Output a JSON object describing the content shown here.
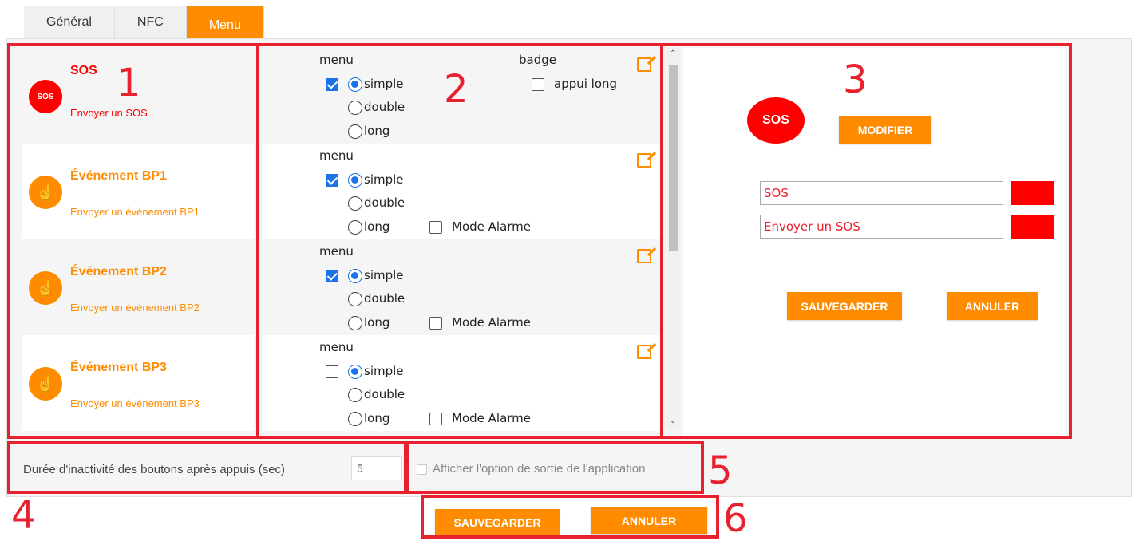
{
  "tabs": [
    {
      "label": "Général"
    },
    {
      "label": "NFC"
    },
    {
      "label": "Menu"
    }
  ],
  "annotations": [
    "1",
    "2",
    "3",
    "4",
    "5",
    "6"
  ],
  "items": [
    {
      "icon": "SOS",
      "title": "SOS",
      "subtitle": "Envoyer un SOS",
      "color": "#ff0000"
    },
    {
      "icon": "hand-press-icon",
      "title": "Événement BP1",
      "subtitle": "Envoyer un événement BP1",
      "color": "#ff8c00"
    },
    {
      "icon": "hand-press-icon",
      "title": "Événement BP2",
      "subtitle": "Envoyer un événement BP2",
      "color": "#ff8c00"
    },
    {
      "icon": "hand-press-icon",
      "title": "Événement BP3",
      "subtitle": "Envoyer un événement BP3",
      "color": "#ff8c00"
    }
  ],
  "config": {
    "menu_label": "menu",
    "badge_label": "badge",
    "long_press_label": "appui long",
    "simple_label": "simple",
    "double_label": "double",
    "long_label": "long",
    "alarm_label": "Mode Alarme",
    "rows": [
      {
        "menu_checked": true,
        "selected": "simple",
        "long_press_checked": false
      },
      {
        "menu_checked": true,
        "selected": "simple",
        "alarm_checked": false
      },
      {
        "menu_checked": true,
        "selected": "simple",
        "alarm_checked": false
      },
      {
        "menu_checked": false,
        "selected": "simple",
        "alarm_checked": false
      }
    ]
  },
  "editor": {
    "icon_label": "SOS",
    "modify_label": "MODIFIER",
    "title_value": "SOS",
    "subtitle_value": "Envoyer un SOS",
    "title_color": "#ff0000",
    "subtitle_color": "#ff0000",
    "save_label": "SAUVEGARDER",
    "cancel_label": "ANNULER"
  },
  "footer": {
    "inactivity_label": "Durée d'inactivité des boutons après appuis (sec)",
    "inactivity_value": "5",
    "exit_option_label": "Afficher l'option de sortie de l'application",
    "exit_option_checked": false,
    "save_label": "SAUVEGARDER",
    "cancel_label": "ANNULER"
  },
  "colors": {
    "accent": "#ff8c00",
    "annotation": "#e8212e",
    "checkbox": "#1a73e8"
  }
}
